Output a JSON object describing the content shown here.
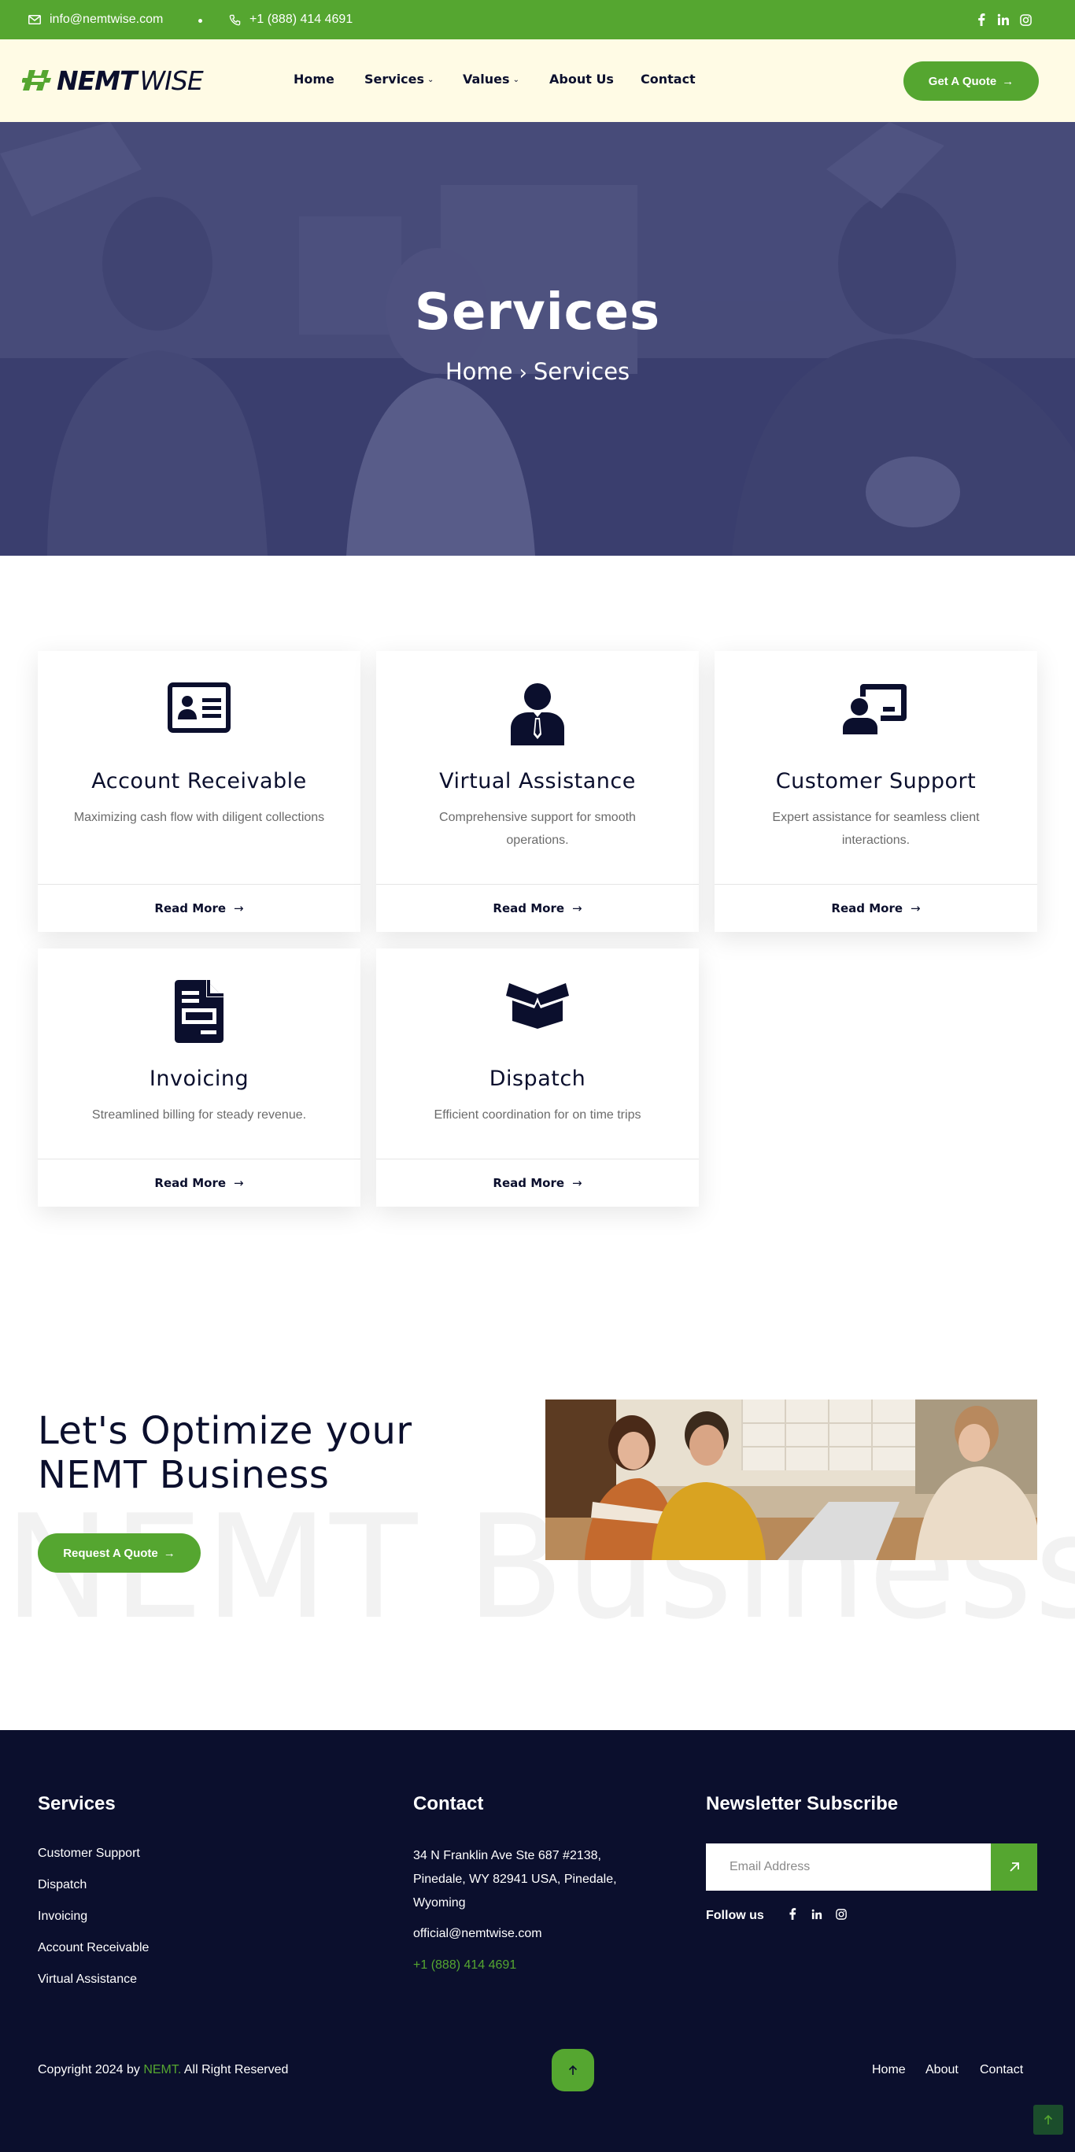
{
  "topbar": {
    "email": "info@nemtwise.com",
    "phone": "+1 (888) 414 4691",
    "social": [
      "facebook-icon",
      "linkedin-icon",
      "instagram-icon"
    ]
  },
  "header": {
    "logo_bold": "NEMT",
    "logo_light": "WISE",
    "nav": [
      {
        "label": "Home"
      },
      {
        "label": "Services",
        "dropdown": true
      },
      {
        "label": "Values",
        "dropdown": true
      },
      {
        "label": "About Us"
      },
      {
        "label": "Contact"
      }
    ],
    "cta_label": "Get A Quote"
  },
  "hero": {
    "title": "Services",
    "crumb_home": "Home",
    "crumb_current": "Services"
  },
  "services": [
    {
      "title": "Account Receivable",
      "desc": "Maximizing cash flow with diligent collections",
      "icon": "id-card-icon",
      "more": "Read More"
    },
    {
      "title": "Virtual Assistance",
      "desc": "Comprehensive support for smooth operations.",
      "icon": "business-person-icon",
      "more": "Read More"
    },
    {
      "title": "Customer Support",
      "desc": "Expert assistance for seamless client interactions.",
      "icon": "presenter-board-icon",
      "more": "Read More"
    },
    {
      "title": "Invoicing",
      "desc": "Streamlined billing for steady revenue.",
      "icon": "invoice-document-icon",
      "more": "Read More"
    },
    {
      "title": "Dispatch",
      "desc": "Efficient coordination for on time trips",
      "icon": "open-box-icon",
      "more": "Read More"
    }
  ],
  "cta": {
    "title": "Let's Optimize your NEMT Business",
    "ghost": "NEMT Business",
    "button": "Request A Quote"
  },
  "footer": {
    "services_heading": "Services",
    "services_links": [
      "Customer Support",
      "Dispatch",
      "Invoicing",
      "Account Receivable",
      "Virtual Assistance"
    ],
    "contact_heading": "Contact",
    "address": "34 N Franklin Ave Ste 687 #2138, Pinedale, WY 82941 USA, Pinedale, Wyoming",
    "email": "official@nemtwise.com",
    "phone": "+1 (888) 414 4691",
    "newsletter_heading": "Newsletter Subscribe",
    "email_placeholder": "Email Address",
    "follow_label": "Follow us",
    "copyright_prefix": "Copyright 2024 by",
    "copyright_brand": "NEMT.",
    "copyright_suffix": "All Right Reserved",
    "bottom_links": [
      "Home",
      "About",
      "Contact"
    ]
  },
  "colors": {
    "brand_green": "#55a630",
    "navy": "#0b0f2d",
    "header_bg": "#fffbe5"
  }
}
